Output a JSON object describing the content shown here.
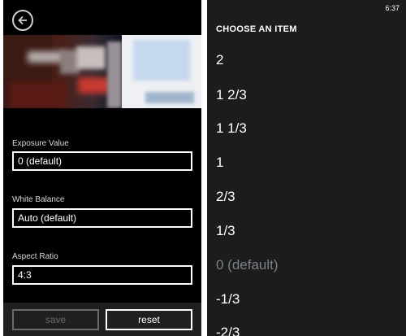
{
  "left": {
    "fields": [
      {
        "label": "Exposure Value",
        "value": "0 (default)"
      },
      {
        "label": "White Balance",
        "value": "Auto (default)"
      },
      {
        "label": "Aspect Ratio",
        "value": "4:3"
      }
    ],
    "buttons": {
      "save": "save",
      "reset": "reset"
    }
  },
  "right": {
    "time": "6:37",
    "title": "CHOOSE AN ITEM",
    "options": [
      "2",
      "1 2/3",
      "1 1/3",
      "1",
      "2/3",
      "1/3",
      "0 (default)",
      "-1/3",
      "-2/3"
    ],
    "selected_option": "0 (default)"
  },
  "colors": {
    "background": "#000000",
    "picker_background": "#1c1c1c",
    "disabled_text": "#6a6a6a",
    "selected_option": "#7a8188"
  },
  "icons": {
    "back": "back-arrow-icon"
  }
}
